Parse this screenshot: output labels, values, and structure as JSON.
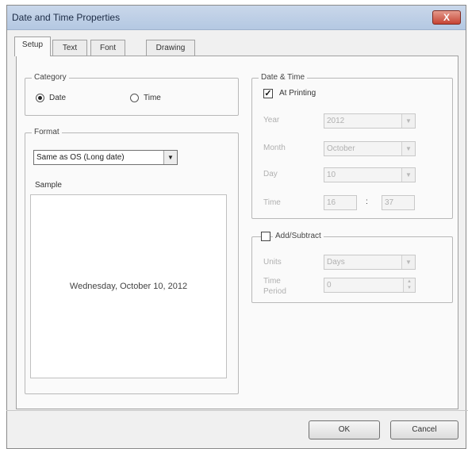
{
  "window": {
    "title": "Date and Time Properties",
    "close_label": "X"
  },
  "tabs": [
    {
      "label": "Setup",
      "active": true
    },
    {
      "label": "Text",
      "active": false
    },
    {
      "label": "Font",
      "active": false
    },
    {
      "label": "Drawing",
      "active": false
    }
  ],
  "category": {
    "legend": "Category",
    "options": [
      {
        "label": "Date",
        "checked": true
      },
      {
        "label": "Time",
        "checked": false
      }
    ]
  },
  "format": {
    "legend": "Format",
    "selected": "Same as OS (Long date)",
    "sample_label": "Sample",
    "sample_value": "Wednesday, October 10, 2012"
  },
  "date_time": {
    "legend": "Date & Time",
    "at_printing_label": "At Printing",
    "at_printing_checked": true,
    "year_label": "Year",
    "year_value": "2012",
    "month_label": "Month",
    "month_value": "October",
    "day_label": "Day",
    "day_value": "10",
    "time_label": "Time",
    "time_hour": "16",
    "time_sep": ":",
    "time_minute": "37"
  },
  "add_subtract": {
    "legend": "Add/Subtract",
    "checked": false,
    "units_label": "Units",
    "units_value": "Days",
    "time_period_label_1": "Time",
    "time_period_label_2": "Period",
    "time_period_value": "0"
  },
  "buttons": {
    "ok": "OK",
    "cancel": "Cancel"
  },
  "icons": {
    "dropdown": "chevron-down-icon",
    "close": "close-icon"
  }
}
